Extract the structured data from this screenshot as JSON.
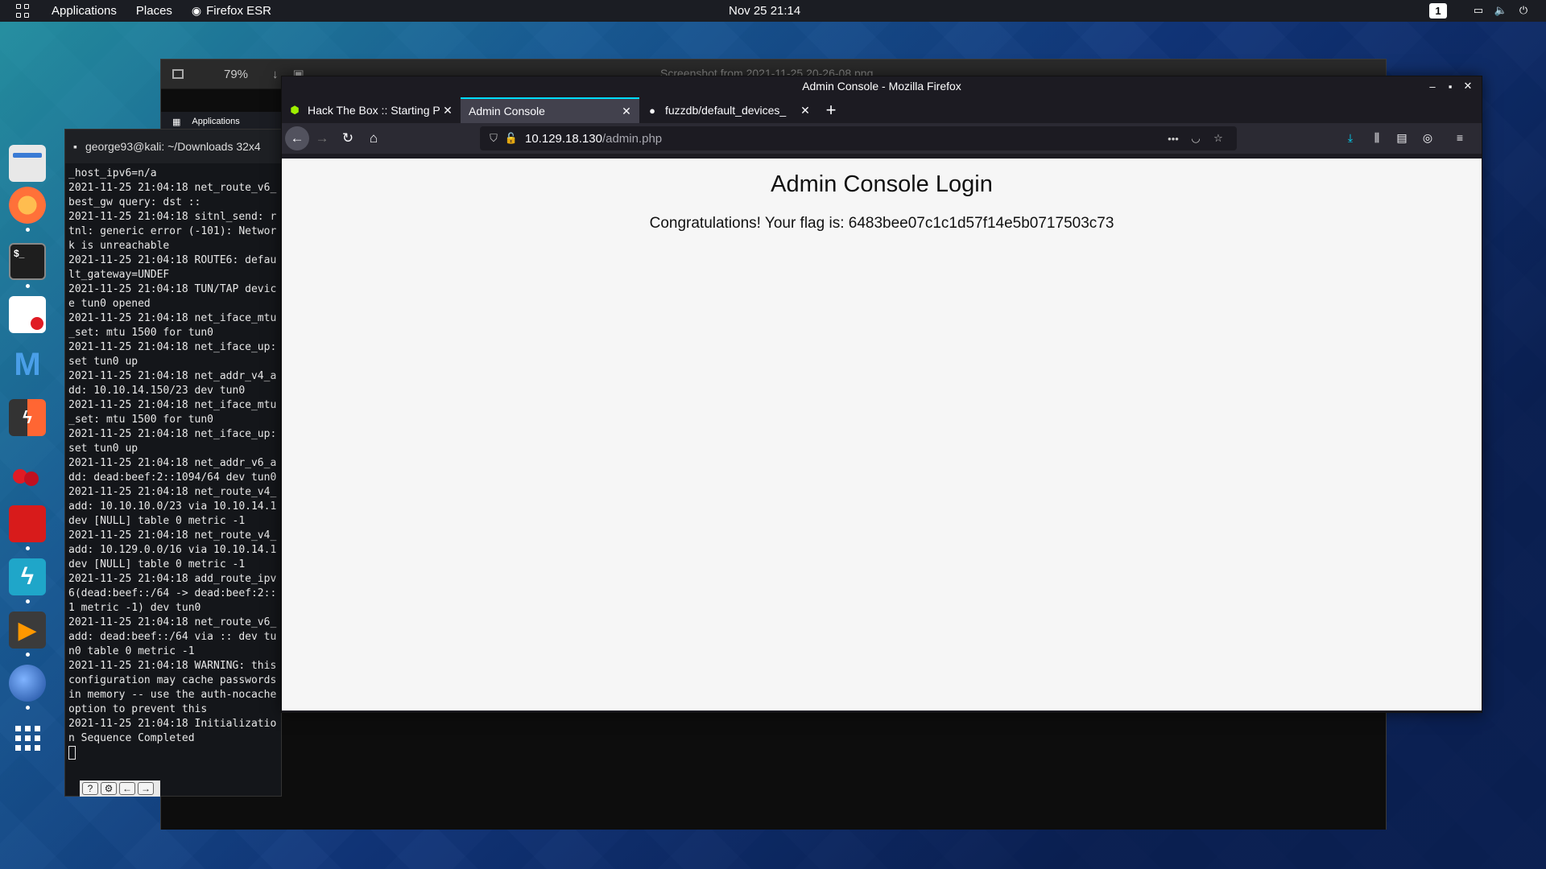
{
  "top_panel": {
    "applications": "Applications",
    "places": "Places",
    "app_name": "Firefox ESR",
    "clock": "Nov 25  21:14",
    "workspace": "1"
  },
  "dock": {
    "items": [
      {
        "name": "files",
        "color": "#e8e8e8"
      },
      {
        "name": "firefox",
        "color": "#ff7139"
      },
      {
        "name": "terminal",
        "color": "#1e1e1e"
      },
      {
        "name": "text-editor",
        "color": "#ffffff"
      },
      {
        "name": "metasploit",
        "color": "#1f6fb8"
      },
      {
        "name": "burpsuite",
        "color": "#ff6633"
      },
      {
        "name": "cherrytree",
        "color": "#d81b2b"
      },
      {
        "name": "red-app",
        "color": "#d81b1b"
      },
      {
        "name": "zap",
        "color": "#1fa6c9"
      },
      {
        "name": "sublime",
        "color": "#3b3b3b"
      },
      {
        "name": "wireshark",
        "color": "#2a6ab8"
      },
      {
        "name": "app-grid",
        "color": "transparent"
      }
    ]
  },
  "viewer": {
    "zoom": "79%",
    "title": "Screenshot from 2021-11-25 20-26-08.png",
    "inner_menu": "Applications"
  },
  "terminal": {
    "title": "george93@kali: ~/Downloads 32x4",
    "lines": "_host_ipv6=n/a\n2021-11-25 21:04:18 net_route_v6_best_gw query: dst ::\n2021-11-25 21:04:18 sitnl_send: rtnl: generic error (-101): Network is unreachable\n2021-11-25 21:04:18 ROUTE6: default_gateway=UNDEF\n2021-11-25 21:04:18 TUN/TAP device tun0 opened\n2021-11-25 21:04:18 net_iface_mtu_set: mtu 1500 for tun0\n2021-11-25 21:04:18 net_iface_up: set tun0 up\n2021-11-25 21:04:18 net_addr_v4_add: 10.10.14.150/23 dev tun0\n2021-11-25 21:04:18 net_iface_mtu_set: mtu 1500 for tun0\n2021-11-25 21:04:18 net_iface_up: set tun0 up\n2021-11-25 21:04:18 net_addr_v6_add: dead:beef:2::1094/64 dev tun0\n2021-11-25 21:04:18 net_route_v4_add: 10.10.10.0/23 via 10.10.14.1 dev [NULL] table 0 metric -1\n2021-11-25 21:04:18 net_route_v4_add: 10.129.0.0/16 via 10.10.14.1 dev [NULL] table 0 metric -1\n2021-11-25 21:04:18 add_route_ipv6(dead:beef::/64 -> dead:beef:2::1 metric -1) dev tun0\n2021-11-25 21:04:18 net_route_v6_add: dead:beef::/64 via :: dev tun0 table 0 metric -1\n2021-11-25 21:04:18 WARNING: this configuration may cache passwords in memory -- use the auth-nocache option to prevent this\n2021-11-25 21:04:18 Initialization Sequence Completed"
  },
  "firefox": {
    "window_title": "Admin Console - Mozilla Firefox",
    "tabs": [
      {
        "label": "Hack The Box :: Starting P",
        "icon": "htb-cube-icon",
        "active": false
      },
      {
        "label": "Admin Console",
        "icon": "",
        "active": true
      },
      {
        "label": "fuzzdb/default_devices_",
        "icon": "github-icon",
        "active": false
      }
    ],
    "url_host": "10.129.18.130",
    "url_path": "/admin.php",
    "accent": "#00ddff"
  },
  "page": {
    "heading": "Admin Console Login",
    "message": "Congratulations! Your flag is: 6483bee07c1c1d57f14e5b0717503c73"
  }
}
